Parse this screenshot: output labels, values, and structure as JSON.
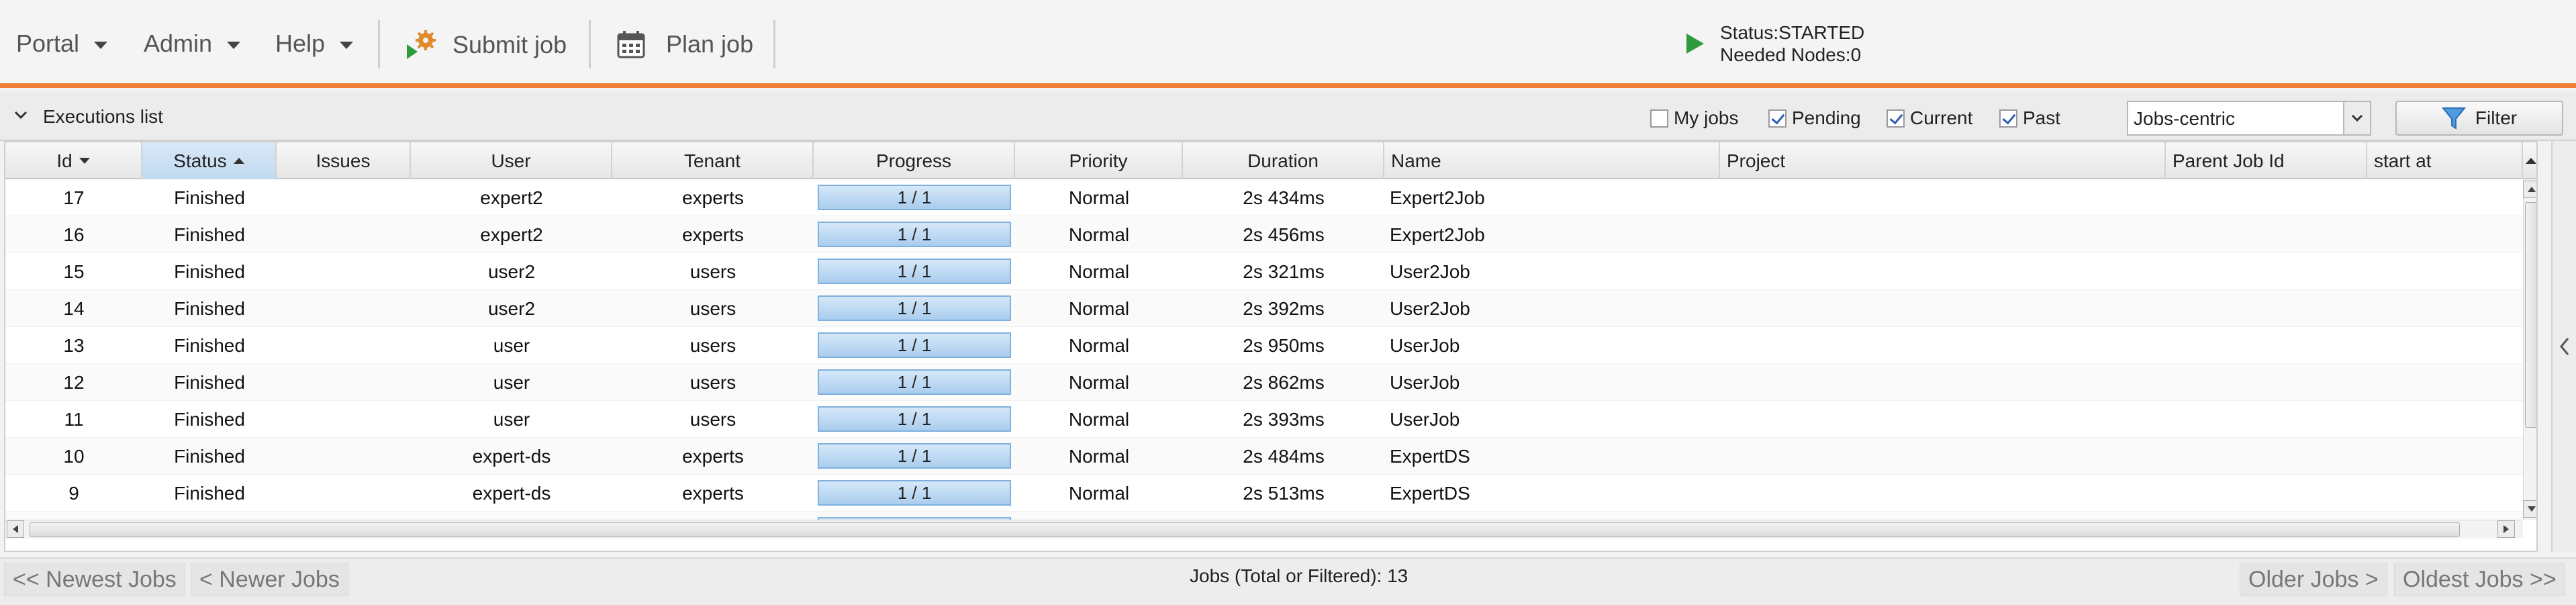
{
  "menu": {
    "portal": "Portal",
    "admin": "Admin",
    "help": "Help",
    "submit_job": "Submit job",
    "plan_job": "Plan job"
  },
  "status": {
    "line1": "Status:STARTED",
    "line2": "Needed Nodes:0"
  },
  "panel": {
    "title": "Executions list",
    "my_jobs": "My jobs",
    "pending": "Pending",
    "current": "Current",
    "past": "Past",
    "view_select": "Jobs-centric",
    "filter": "Filter"
  },
  "columns": {
    "id": "Id",
    "status": "Status",
    "issues": "Issues",
    "user": "User",
    "tenant": "Tenant",
    "progress": "Progress",
    "priority": "Priority",
    "duration": "Duration",
    "name": "Name",
    "project": "Project",
    "parent_job_id": "Parent Job Id",
    "start_at": "start at"
  },
  "rows": [
    {
      "id": "17",
      "status": "Finished",
      "issues": "",
      "user": "expert2",
      "tenant": "experts",
      "progress": "1 / 1",
      "priority": "Normal",
      "duration": "2s 434ms",
      "name": "Expert2Job"
    },
    {
      "id": "16",
      "status": "Finished",
      "issues": "",
      "user": "expert2",
      "tenant": "experts",
      "progress": "1 / 1",
      "priority": "Normal",
      "duration": "2s 456ms",
      "name": "Expert2Job"
    },
    {
      "id": "15",
      "status": "Finished",
      "issues": "",
      "user": "user2",
      "tenant": "users",
      "progress": "1 / 1",
      "priority": "Normal",
      "duration": "2s 321ms",
      "name": "User2Job"
    },
    {
      "id": "14",
      "status": "Finished",
      "issues": "",
      "user": "user2",
      "tenant": "users",
      "progress": "1 / 1",
      "priority": "Normal",
      "duration": "2s 392ms",
      "name": "User2Job"
    },
    {
      "id": "13",
      "status": "Finished",
      "issues": "",
      "user": "user",
      "tenant": "users",
      "progress": "1 / 1",
      "priority": "Normal",
      "duration": "2s 950ms",
      "name": "UserJob"
    },
    {
      "id": "12",
      "status": "Finished",
      "issues": "",
      "user": "user",
      "tenant": "users",
      "progress": "1 / 1",
      "priority": "Normal",
      "duration": "2s 862ms",
      "name": "UserJob"
    },
    {
      "id": "11",
      "status": "Finished",
      "issues": "",
      "user": "user",
      "tenant": "users",
      "progress": "1 / 1",
      "priority": "Normal",
      "duration": "2s 393ms",
      "name": "UserJob"
    },
    {
      "id": "10",
      "status": "Finished",
      "issues": "",
      "user": "expert-ds",
      "tenant": "experts",
      "progress": "1 / 1",
      "priority": "Normal",
      "duration": "2s 484ms",
      "name": "ExpertDS"
    },
    {
      "id": "9",
      "status": "Finished",
      "issues": "",
      "user": "expert-ds",
      "tenant": "experts",
      "progress": "1 / 1",
      "priority": "Normal",
      "duration": "2s 513ms",
      "name": "ExpertDS"
    }
  ],
  "footer": {
    "newest": "<< Newest Jobs",
    "newer": "< Newer Jobs",
    "count": "Jobs (Total or Filtered): 13",
    "older": "Older Jobs >",
    "oldest": "Oldest Jobs >>"
  },
  "colors": {
    "accent": "#ef7d34",
    "progress": "#a9cdee",
    "status_play": "#2e9c3e"
  }
}
